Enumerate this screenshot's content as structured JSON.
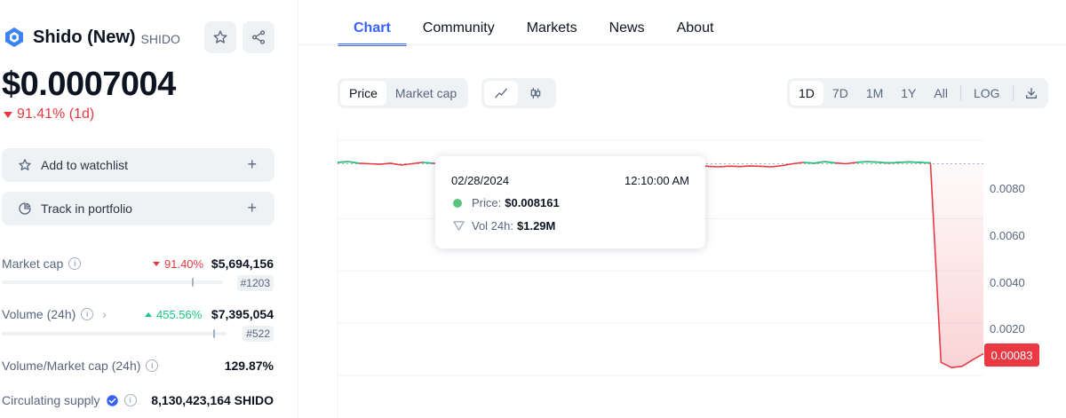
{
  "coin": {
    "name": "Shido (New)",
    "symbol": "SHIDO",
    "price": "$0.0007004",
    "change_1d": "91.41% (1d)",
    "colors": {
      "accent": "#3861fb",
      "down": "#ea3943",
      "up": "#16c784"
    }
  },
  "actions": {
    "watchlist_label": "Add to watchlist",
    "portfolio_label": "Track in portfolio"
  },
  "stats": {
    "market_cap": {
      "label": "Market cap",
      "change": "91.40%",
      "value": "$5,694,156",
      "rank": "#1203",
      "bar_fill": 0.86
    },
    "volume": {
      "label": "Volume (24h)",
      "change": "455.56%",
      "value": "$7,395,054",
      "rank": "#522",
      "bar_fill": 0.95
    },
    "vol_mcap": {
      "label": "Volume/Market cap (24h)",
      "value": "129.87%"
    },
    "supply": {
      "label": "Circulating supply",
      "value": "8,130,423,164 SHIDO"
    }
  },
  "tabs": [
    "Chart",
    "Community",
    "Markets",
    "News",
    "About"
  ],
  "chart_controls": {
    "type_toggle": [
      "Price",
      "Market cap"
    ],
    "ranges": [
      "1D",
      "7D",
      "1M",
      "1Y",
      "All"
    ],
    "log_label": "LOG"
  },
  "tooltip": {
    "date": "02/28/2024",
    "time": "12:10:00 AM",
    "price_label": "Price:",
    "price_value": "$0.008161",
    "vol_label": "Vol 24h:",
    "vol_value": "$1.29M"
  },
  "chart_data": {
    "type": "area",
    "title": "",
    "xlabel": "",
    "ylabel": "",
    "y_ticks": [
      "0.0080",
      "0.0060",
      "0.0040",
      "0.0020"
    ],
    "current_value_label": "0.00083",
    "ylim": [
      0,
      0.009
    ],
    "series": [
      {
        "values": [
          0.00815,
          0.00818,
          0.00812,
          0.0081,
          0.00808,
          0.00812,
          0.00805,
          0.0081,
          0.00815,
          0.00812,
          0.00809,
          0.00811,
          0.00813,
          0.0081,
          0.00808,
          0.00806,
          0.00809,
          0.00812,
          0.00808,
          0.00805,
          0.00803,
          0.00806,
          0.0081,
          0.00812,
          0.00809,
          0.00811,
          0.00815,
          0.00812,
          0.00808,
          0.00806,
          0.00809,
          0.00802,
          0.008,
          0.00803,
          0.00806,
          0.008,
          0.00798,
          0.00801,
          0.00799,
          0.00802,
          0.008,
          0.00798,
          0.00803,
          0.0081,
          0.00815,
          0.00812,
          0.00818,
          0.00813,
          0.0081,
          0.00815,
          0.00818,
          0.00816,
          0.00813,
          0.00815,
          0.00817,
          0.00815,
          0.00813,
          0.0005,
          0.0003,
          0.00035,
          0.0006,
          0.00083
        ]
      }
    ]
  }
}
